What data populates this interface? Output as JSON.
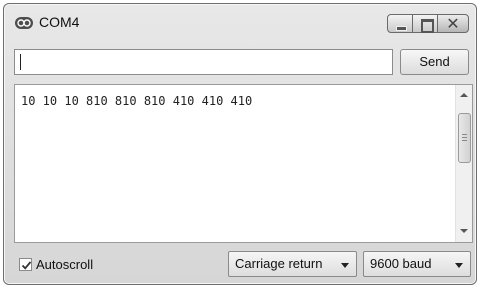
{
  "window": {
    "title": "COM4",
    "icon": "arduino-infinity-icon",
    "controls": [
      "minimize-icon",
      "maximize-icon",
      "close-icon"
    ]
  },
  "input": {
    "value": "",
    "send_label": "Send"
  },
  "output": {
    "text": "10 10 10 810 810 810 410 410 410"
  },
  "footer": {
    "autoscroll_label": "Autoscroll",
    "autoscroll_checked": true,
    "line_ending": "Carriage return",
    "baud": "9600 baud"
  }
}
